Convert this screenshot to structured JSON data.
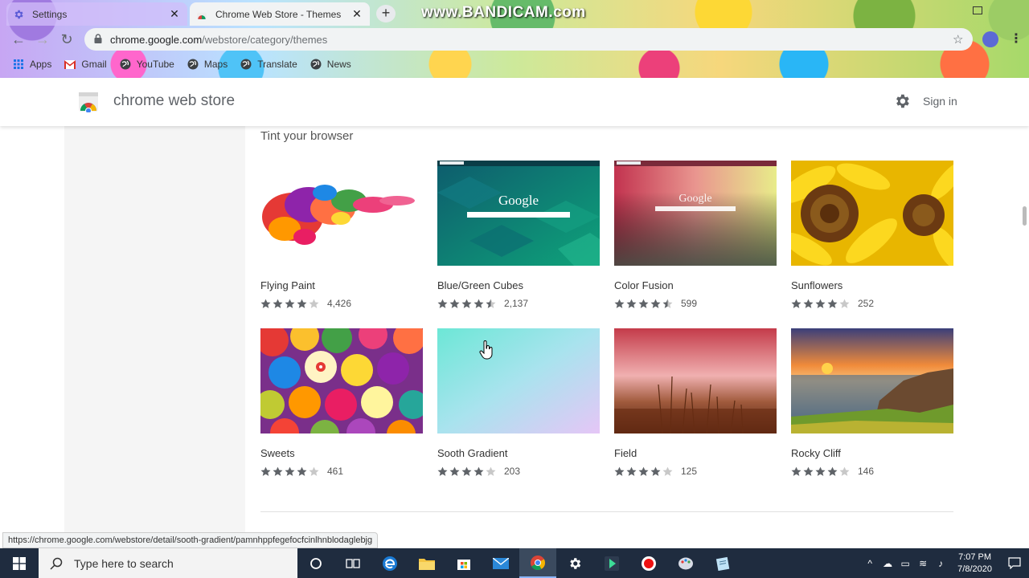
{
  "browser": {
    "tabs": [
      {
        "title": "Settings",
        "active": false
      },
      {
        "title": "Chrome Web Store - Themes",
        "active": true
      }
    ],
    "watermark": "www.BANDICAM.com",
    "url_domain": "chrome.google.com",
    "url_path": "/webstore/category/themes",
    "bookmarks": [
      "Apps",
      "Gmail",
      "YouTube",
      "Maps",
      "Translate",
      "News"
    ]
  },
  "store": {
    "name": "chrome web store",
    "signin": "Sign in",
    "section_title": "Tint your browser",
    "themes": [
      {
        "name": "Flying Paint",
        "stars": 4,
        "count": "4,426"
      },
      {
        "name": "Blue/Green Cubes",
        "stars": 4.5,
        "count": "2,137"
      },
      {
        "name": "Color Fusion",
        "stars": 4.5,
        "count": "599"
      },
      {
        "name": "Sunflowers",
        "stars": 4,
        "count": "252"
      },
      {
        "name": "Sweets",
        "stars": 4,
        "count": "461"
      },
      {
        "name": "Sooth Gradient",
        "stars": 4,
        "count": "203"
      },
      {
        "name": "Field",
        "stars": 4,
        "count": "125"
      },
      {
        "name": "Rocky Cliff",
        "stars": 4,
        "count": "146"
      }
    ],
    "thumb_text": {
      "google": "Google"
    }
  },
  "status_url": "https://chrome.google.com/webstore/detail/sooth-gradient/pamnhppfegefocfcinlhnblodaglebjg",
  "taskbar": {
    "search_placeholder": "Type here to search",
    "time": "7:07 PM",
    "date": "7/8/2020"
  },
  "colors": {
    "star": "#5f6368",
    "star_empty": "#c8c8c8",
    "taskbar": "#1f2c3f"
  }
}
